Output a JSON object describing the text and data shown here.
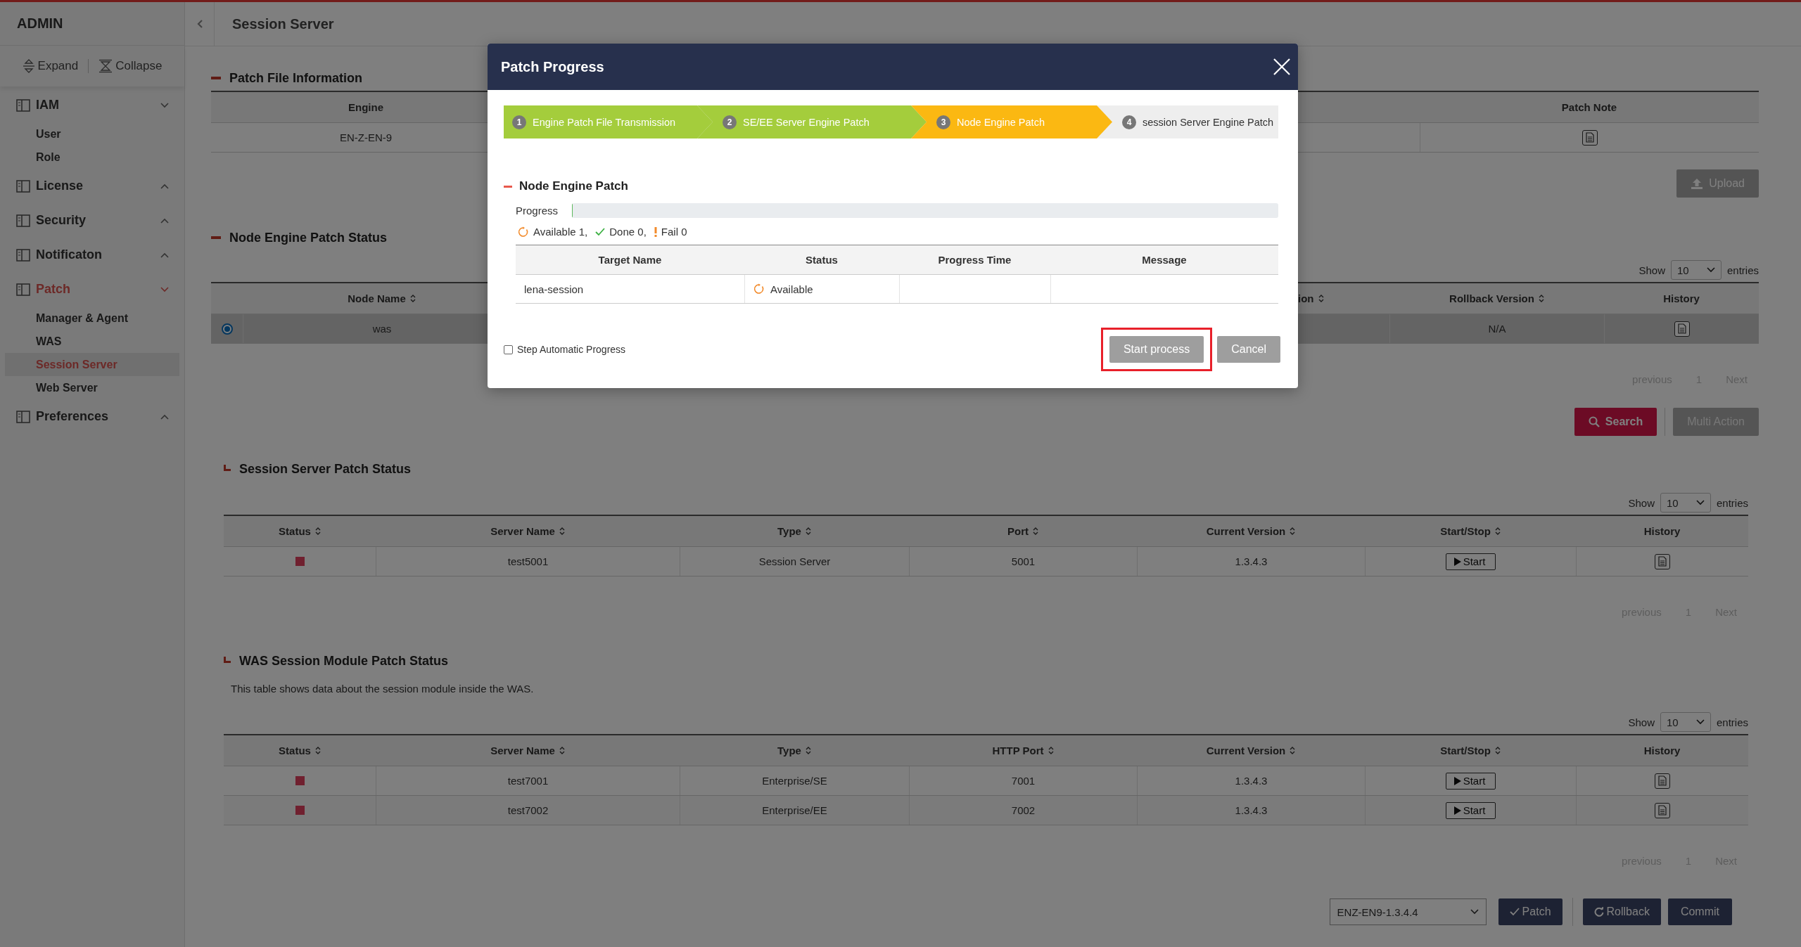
{
  "sidebar": {
    "title": "ADMIN",
    "expand": "Expand",
    "collapse": "Collapse",
    "items": [
      {
        "label": "IAM",
        "expanded": true,
        "selected": false,
        "children": [
          {
            "label": "User",
            "selected": false
          },
          {
            "label": "Role",
            "selected": false
          }
        ]
      },
      {
        "label": "License",
        "expanded": false,
        "selected": false
      },
      {
        "label": "Security",
        "expanded": false,
        "selected": false
      },
      {
        "label": "Notificaton",
        "expanded": false,
        "selected": false
      },
      {
        "label": "Patch",
        "expanded": true,
        "selected": true,
        "children": [
          {
            "label": "Manager & Agent",
            "selected": false
          },
          {
            "label": "WAS",
            "selected": false
          },
          {
            "label": "Session Server",
            "selected": true
          },
          {
            "label": "Web Server",
            "selected": false
          }
        ]
      },
      {
        "label": "Preferences",
        "expanded": false,
        "selected": false
      }
    ]
  },
  "header": {
    "title": "Session Server"
  },
  "patch_file_information": {
    "title": "Patch File Information",
    "kind": "main",
    "columns": [
      {
        "label": "Engine",
        "kind": "text",
        "sortable": false
      },
      {
        "label": "Patch Note",
        "kind": "doc",
        "sortable": false
      }
    ],
    "rows": [
      {
        "cells": [
          "EN-Z-EN-9",
          ""
        ]
      }
    ],
    "upload_button": "Upload"
  },
  "node_engine_patch_status": {
    "title": "Node Engine Patch Status",
    "kind": "main",
    "show": {
      "label": "Show",
      "value": "10",
      "suffix": "entries"
    },
    "columns": [
      {
        "kind": "radio",
        "sortable": false
      },
      {
        "label": "Node Name",
        "kind": "text",
        "sortable": true
      },
      {
        "label": "ion",
        "kind": "blank",
        "sortable": true
      },
      {
        "label": "Rollback Version",
        "kind": "text",
        "sortable": true
      },
      {
        "label": "History",
        "kind": "doc",
        "sortable": false
      }
    ],
    "rows": [
      {
        "selected": true,
        "cells": [
          "",
          "was",
          "",
          "N/A",
          ""
        ]
      }
    ],
    "pagination": {
      "previous": "previous",
      "page": "1",
      "next": "Next"
    },
    "search_button": "Search",
    "multi_action_button": "Multi Action"
  },
  "session_server_patch_status": {
    "title": "Session Server Patch Status",
    "kind": "sub",
    "show": {
      "label": "Show",
      "value": "10",
      "suffix": "entries"
    },
    "columns": [
      {
        "label": "Status",
        "kind": "status",
        "sortable": true
      },
      {
        "label": "Server Name",
        "kind": "text",
        "sortable": true
      },
      {
        "label": "Type",
        "kind": "text",
        "sortable": true
      },
      {
        "label": "Port",
        "kind": "text",
        "sortable": true
      },
      {
        "label": "Current Version",
        "kind": "text",
        "sortable": true
      },
      {
        "label": "Start/Stop",
        "kind": "button",
        "sortable": true
      },
      {
        "label": "History",
        "kind": "doc",
        "sortable": false
      }
    ],
    "rows": [
      {
        "running": false,
        "cells": [
          "",
          "test5001",
          "Session Server",
          "5001",
          "1.3.4.3",
          "Start",
          ""
        ]
      }
    ],
    "pagination": {
      "previous": "previous",
      "page": "1",
      "next": "Next"
    }
  },
  "was_session_module_patch_status": {
    "title": "WAS Session Module Patch Status",
    "kind": "sub",
    "description": "This table shows data about the session module inside the WAS.",
    "show": {
      "label": "Show",
      "value": "10",
      "suffix": "entries"
    },
    "columns": [
      {
        "label": "Status",
        "kind": "status",
        "sortable": true
      },
      {
        "label": "Server Name",
        "kind": "text",
        "sortable": true
      },
      {
        "label": "Type",
        "kind": "text",
        "sortable": true
      },
      {
        "label": "HTTP Port",
        "kind": "text",
        "sortable": true
      },
      {
        "label": "Current Version",
        "kind": "text",
        "sortable": true
      },
      {
        "label": "Start/Stop",
        "kind": "button",
        "sortable": true
      },
      {
        "label": "History",
        "kind": "doc",
        "sortable": false
      }
    ],
    "rows": [
      {
        "running": false,
        "cells": [
          "",
          "test7001",
          "Enterprise/SE",
          "7001",
          "1.3.4.3",
          "Start",
          ""
        ]
      },
      {
        "running": false,
        "cells": [
          "",
          "test7002",
          "Enterprise/EE",
          "7002",
          "1.3.4.3",
          "Start",
          ""
        ]
      }
    ],
    "pagination": {
      "previous": "previous",
      "page": "1",
      "next": "Next"
    }
  },
  "footer": {
    "version_select": "ENZ-EN9-1.3.4.4",
    "patch_button": "Patch",
    "rollback_button": "Rollback",
    "commit_button": "Commit"
  },
  "modal": {
    "title": "Patch Progress",
    "steps": [
      {
        "number": "1",
        "label": "Engine Patch File Transmission",
        "selected": false
      },
      {
        "number": "2",
        "label": "SE/EE Server Engine Patch",
        "selected": false
      },
      {
        "number": "3",
        "label": "Node Engine Patch",
        "selected": true
      },
      {
        "number": "4",
        "label": "session Server Engine Patch",
        "selected": false
      }
    ],
    "section_title": "Node Engine Patch",
    "progress": {
      "label": "Progress",
      "level": 0
    },
    "counts": [
      {
        "kind": "available",
        "text": "Available 1,"
      },
      {
        "kind": "done",
        "text": "Done 0,"
      },
      {
        "kind": "fail",
        "text": "Fail 0"
      }
    ],
    "columns": [
      "Target Name",
      "Status",
      "Progress Time",
      "Message"
    ],
    "rows": [
      {
        "target": "lena-session",
        "status": {
          "kind": "available",
          "text": "Available"
        }
      }
    ],
    "auto_progress": {
      "label": "Step Automatic Progress",
      "checked": false
    },
    "buttons": [
      {
        "label": "Start process",
        "highlighted": true
      },
      {
        "label": "Cancel",
        "highlighted": false
      }
    ]
  }
}
